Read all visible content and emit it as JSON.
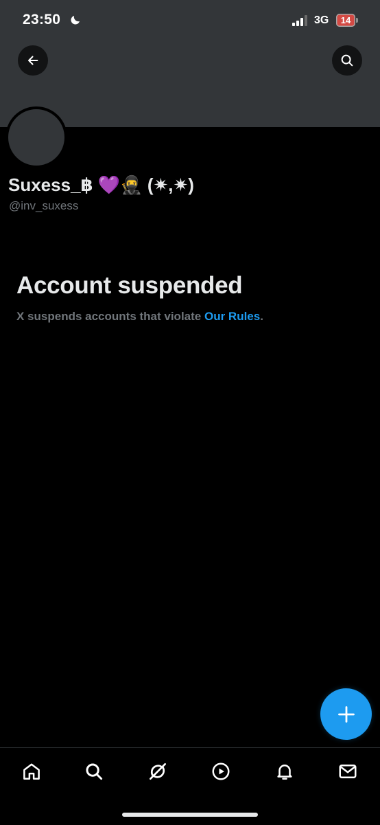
{
  "status_bar": {
    "time": "23:50",
    "network": "3G",
    "battery": "14",
    "icons": [
      "moon-icon",
      "signal-icon"
    ]
  },
  "header": {
    "back_icon": "arrow-left-icon",
    "search_icon": "search-icon"
  },
  "profile": {
    "name": "Suxess_฿",
    "name_emoji": "💜🥷",
    "name_suffix": "(✷,✷)",
    "handle": "@inv_suxess"
  },
  "suspension": {
    "title": "Account suspended",
    "message": "X suspends accounts that violate ",
    "link_text": "Our Rules",
    "message_end": "."
  },
  "fab": {
    "icon": "plus-icon"
  },
  "bottom_nav": {
    "items": [
      "home-icon",
      "search-icon",
      "grok-icon",
      "video-icon",
      "notifications-icon",
      "messages-icon"
    ]
  },
  "colors": {
    "background": "#000000",
    "banner": "#333639",
    "accent": "#1d9bf0",
    "primary_text": "#e7e9ea",
    "secondary_text": "#71767b",
    "battery_low": "#d44a44"
  }
}
